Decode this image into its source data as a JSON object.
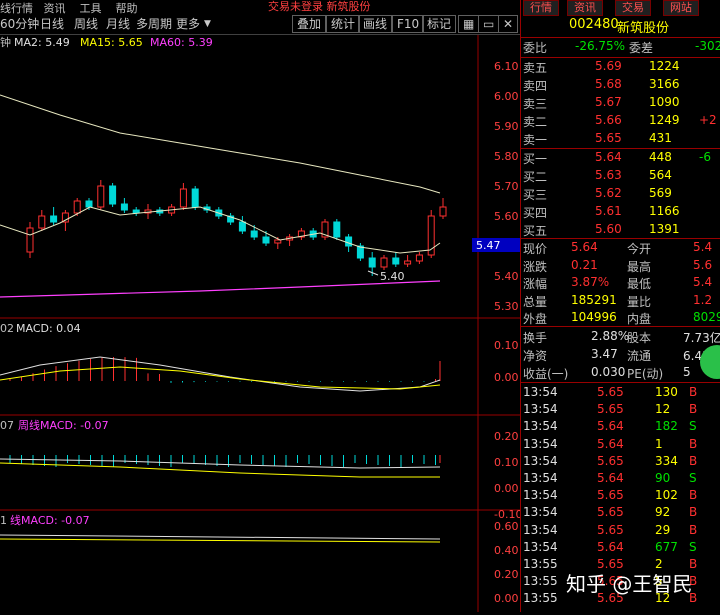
{
  "topbar": {
    "text": "交易未登录  新筑股份"
  },
  "toolbar": {
    "items": [
      "60分钟",
      "日线",
      "周线",
      "月线",
      "多周期",
      "更多"
    ],
    "buttons": [
      "叠加",
      "统计",
      "画线",
      "F10",
      "标记"
    ],
    "menu_left": [
      "线行情",
      "资讯",
      "工具",
      "帮助"
    ]
  },
  "main_chart": {
    "header_prefix": "钟",
    "ma2": "MA2: 5.49",
    "ma15": "MA15: 5.65",
    "ma60": "MA60: 5.39",
    "y_ticks": [
      "6.10",
      "6.00",
      "5.90",
      "5.80",
      "5.70",
      "5.60",
      "5.50",
      "5.40",
      "5.30"
    ],
    "current_price_label": "5.47",
    "low_annotation": "5.40"
  },
  "macd1": {
    "prefix": "02",
    "label": "MACD: 0.04",
    "y_ticks": [
      "0.10",
      "0.00"
    ]
  },
  "macd2": {
    "prefix": "07",
    "label": "周线MACD: -0.07",
    "y_ticks": [
      "0.20",
      "0.10",
      "0.00",
      "-0.10"
    ]
  },
  "macd3": {
    "prefix": "1",
    "label": "线MACD: -0.07",
    "y_ticks": [
      "0.60",
      "0.40",
      "0.20",
      "0.00"
    ]
  },
  "right_tabs": [
    "行情",
    "资讯",
    "交易",
    "网站"
  ],
  "stock": {
    "code": "002480",
    "name": "新筑股份"
  },
  "weibi": {
    "label": "委比",
    "value": "-26.75%",
    "label2": "委差",
    "value2": "-302"
  },
  "sells": [
    {
      "label": "卖五",
      "price": "5.69",
      "vol": "1224",
      "chg": ""
    },
    {
      "label": "卖四",
      "price": "5.68",
      "vol": "3166",
      "chg": ""
    },
    {
      "label": "卖三",
      "price": "5.67",
      "vol": "1090",
      "chg": ""
    },
    {
      "label": "卖二",
      "price": "5.66",
      "vol": "1249",
      "chg": "+2"
    },
    {
      "label": "卖一",
      "price": "5.65",
      "vol": "431",
      "chg": ""
    }
  ],
  "buys": [
    {
      "label": "买一",
      "price": "5.64",
      "vol": "448",
      "chg": "-6"
    },
    {
      "label": "买二",
      "price": "5.63",
      "vol": "564",
      "chg": ""
    },
    {
      "label": "买三",
      "price": "5.62",
      "vol": "569",
      "chg": ""
    },
    {
      "label": "买四",
      "price": "5.61",
      "vol": "1166",
      "chg": ""
    },
    {
      "label": "买五",
      "price": "5.60",
      "vol": "1391",
      "chg": ""
    }
  ],
  "quote": [
    {
      "l1": "现价",
      "v1": "5.64",
      "l2": "今开",
      "v2": "5.4"
    },
    {
      "l1": "涨跌",
      "v1": "0.21",
      "l2": "最高",
      "v2": "5.6"
    },
    {
      "l1": "涨幅",
      "v1": "3.87%",
      "l2": "最低",
      "v2": "5.4"
    },
    {
      "l1": "总量",
      "v1": "185291",
      "l2": "量比",
      "v2": "1.2"
    },
    {
      "l1": "外盘",
      "v1": "104996",
      "l2": "内盘",
      "v2": "8029"
    }
  ],
  "fund": [
    {
      "l1": "换手",
      "v1": "2.88%",
      "l2": "股本",
      "v2": "7.73亿"
    },
    {
      "l1": "净资",
      "v1": "3.47",
      "l2": "流通",
      "v2": "6.43亿"
    },
    {
      "l1": "收益(一)",
      "v1": "0.030",
      "l2": "PE(动)",
      "v2": "5"
    }
  ],
  "ticks": [
    {
      "t": "13:54",
      "p": "5.65",
      "v": "130",
      "s": "B"
    },
    {
      "t": "13:54",
      "p": "5.65",
      "v": "12",
      "s": "B"
    },
    {
      "t": "13:54",
      "p": "5.64",
      "v": "182",
      "s": "S"
    },
    {
      "t": "13:54",
      "p": "5.64",
      "v": "1",
      "s": "B"
    },
    {
      "t": "13:54",
      "p": "5.65",
      "v": "334",
      "s": "B"
    },
    {
      "t": "13:54",
      "p": "5.64",
      "v": "90",
      "s": "S"
    },
    {
      "t": "13:54",
      "p": "5.65",
      "v": "102",
      "s": "B"
    },
    {
      "t": "13:54",
      "p": "5.65",
      "v": "92",
      "s": "B"
    },
    {
      "t": "13:54",
      "p": "5.65",
      "v": "29",
      "s": "B"
    },
    {
      "t": "13:54",
      "p": "5.64",
      "v": "677",
      "s": "S"
    },
    {
      "t": "13:55",
      "p": "5.65",
      "v": "2",
      "s": "B"
    },
    {
      "t": "13:55",
      "p": "5.65",
      "v": "5",
      "s": "B"
    },
    {
      "t": "13:55",
      "p": "5.65",
      "v": "12",
      "s": "B"
    }
  ],
  "watermark": "知乎 @王智民",
  "colors": {
    "up": "#ff3030",
    "down": "#00d8d8",
    "yellow": "#ffff00",
    "green": "#00e000",
    "ma60": "#ff40ff",
    "ma15": "#e8e8c0"
  }
}
